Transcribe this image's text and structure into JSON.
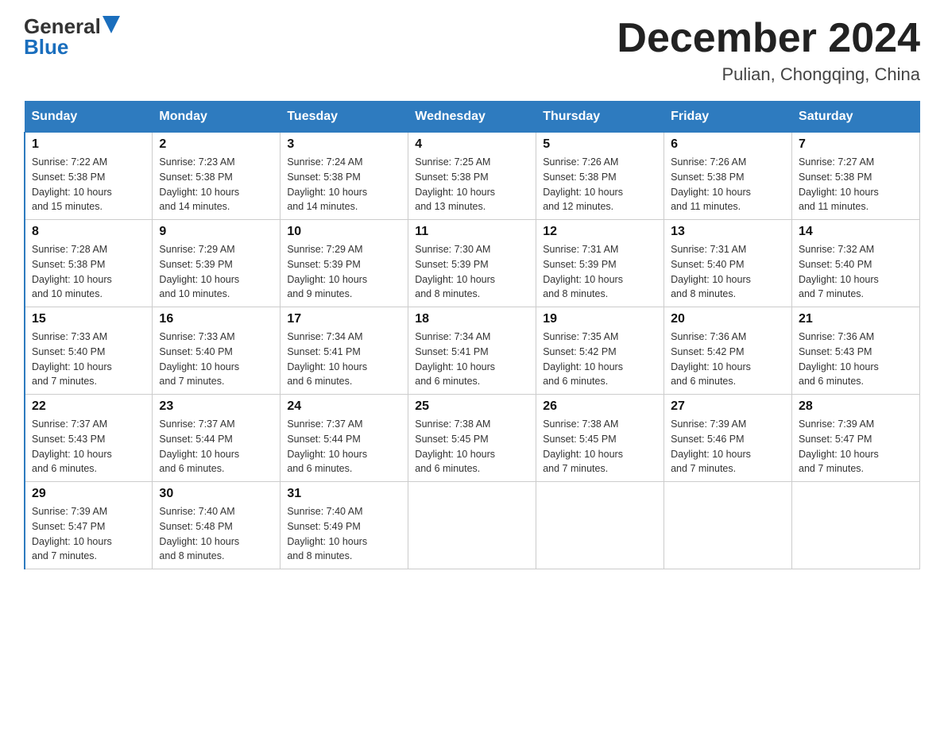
{
  "header": {
    "logo_general": "General",
    "logo_blue": "Blue",
    "month_title": "December 2024",
    "location": "Pulian, Chongqing, China"
  },
  "days_of_week": [
    "Sunday",
    "Monday",
    "Tuesday",
    "Wednesday",
    "Thursday",
    "Friday",
    "Saturday"
  ],
  "weeks": [
    [
      {
        "day": "1",
        "sunrise": "7:22 AM",
        "sunset": "5:38 PM",
        "daylight": "10 hours and 15 minutes."
      },
      {
        "day": "2",
        "sunrise": "7:23 AM",
        "sunset": "5:38 PM",
        "daylight": "10 hours and 14 minutes."
      },
      {
        "day": "3",
        "sunrise": "7:24 AM",
        "sunset": "5:38 PM",
        "daylight": "10 hours and 14 minutes."
      },
      {
        "day": "4",
        "sunrise": "7:25 AM",
        "sunset": "5:38 PM",
        "daylight": "10 hours and 13 minutes."
      },
      {
        "day": "5",
        "sunrise": "7:26 AM",
        "sunset": "5:38 PM",
        "daylight": "10 hours and 12 minutes."
      },
      {
        "day": "6",
        "sunrise": "7:26 AM",
        "sunset": "5:38 PM",
        "daylight": "10 hours and 11 minutes."
      },
      {
        "day": "7",
        "sunrise": "7:27 AM",
        "sunset": "5:38 PM",
        "daylight": "10 hours and 11 minutes."
      }
    ],
    [
      {
        "day": "8",
        "sunrise": "7:28 AM",
        "sunset": "5:38 PM",
        "daylight": "10 hours and 10 minutes."
      },
      {
        "day": "9",
        "sunrise": "7:29 AM",
        "sunset": "5:39 PM",
        "daylight": "10 hours and 10 minutes."
      },
      {
        "day": "10",
        "sunrise": "7:29 AM",
        "sunset": "5:39 PM",
        "daylight": "10 hours and 9 minutes."
      },
      {
        "day": "11",
        "sunrise": "7:30 AM",
        "sunset": "5:39 PM",
        "daylight": "10 hours and 8 minutes."
      },
      {
        "day": "12",
        "sunrise": "7:31 AM",
        "sunset": "5:39 PM",
        "daylight": "10 hours and 8 minutes."
      },
      {
        "day": "13",
        "sunrise": "7:31 AM",
        "sunset": "5:40 PM",
        "daylight": "10 hours and 8 minutes."
      },
      {
        "day": "14",
        "sunrise": "7:32 AM",
        "sunset": "5:40 PM",
        "daylight": "10 hours and 7 minutes."
      }
    ],
    [
      {
        "day": "15",
        "sunrise": "7:33 AM",
        "sunset": "5:40 PM",
        "daylight": "10 hours and 7 minutes."
      },
      {
        "day": "16",
        "sunrise": "7:33 AM",
        "sunset": "5:40 PM",
        "daylight": "10 hours and 7 minutes."
      },
      {
        "day": "17",
        "sunrise": "7:34 AM",
        "sunset": "5:41 PM",
        "daylight": "10 hours and 6 minutes."
      },
      {
        "day": "18",
        "sunrise": "7:34 AM",
        "sunset": "5:41 PM",
        "daylight": "10 hours and 6 minutes."
      },
      {
        "day": "19",
        "sunrise": "7:35 AM",
        "sunset": "5:42 PM",
        "daylight": "10 hours and 6 minutes."
      },
      {
        "day": "20",
        "sunrise": "7:36 AM",
        "sunset": "5:42 PM",
        "daylight": "10 hours and 6 minutes."
      },
      {
        "day": "21",
        "sunrise": "7:36 AM",
        "sunset": "5:43 PM",
        "daylight": "10 hours and 6 minutes."
      }
    ],
    [
      {
        "day": "22",
        "sunrise": "7:37 AM",
        "sunset": "5:43 PM",
        "daylight": "10 hours and 6 minutes."
      },
      {
        "day": "23",
        "sunrise": "7:37 AM",
        "sunset": "5:44 PM",
        "daylight": "10 hours and 6 minutes."
      },
      {
        "day": "24",
        "sunrise": "7:37 AM",
        "sunset": "5:44 PM",
        "daylight": "10 hours and 6 minutes."
      },
      {
        "day": "25",
        "sunrise": "7:38 AM",
        "sunset": "5:45 PM",
        "daylight": "10 hours and 6 minutes."
      },
      {
        "day": "26",
        "sunrise": "7:38 AM",
        "sunset": "5:45 PM",
        "daylight": "10 hours and 7 minutes."
      },
      {
        "day": "27",
        "sunrise": "7:39 AM",
        "sunset": "5:46 PM",
        "daylight": "10 hours and 7 minutes."
      },
      {
        "day": "28",
        "sunrise": "7:39 AM",
        "sunset": "5:47 PM",
        "daylight": "10 hours and 7 minutes."
      }
    ],
    [
      {
        "day": "29",
        "sunrise": "7:39 AM",
        "sunset": "5:47 PM",
        "daylight": "10 hours and 7 minutes."
      },
      {
        "day": "30",
        "sunrise": "7:40 AM",
        "sunset": "5:48 PM",
        "daylight": "10 hours and 8 minutes."
      },
      {
        "day": "31",
        "sunrise": "7:40 AM",
        "sunset": "5:49 PM",
        "daylight": "10 hours and 8 minutes."
      },
      null,
      null,
      null,
      null
    ]
  ],
  "labels": {
    "sunrise": "Sunrise:",
    "sunset": "Sunset:",
    "daylight": "Daylight:"
  }
}
